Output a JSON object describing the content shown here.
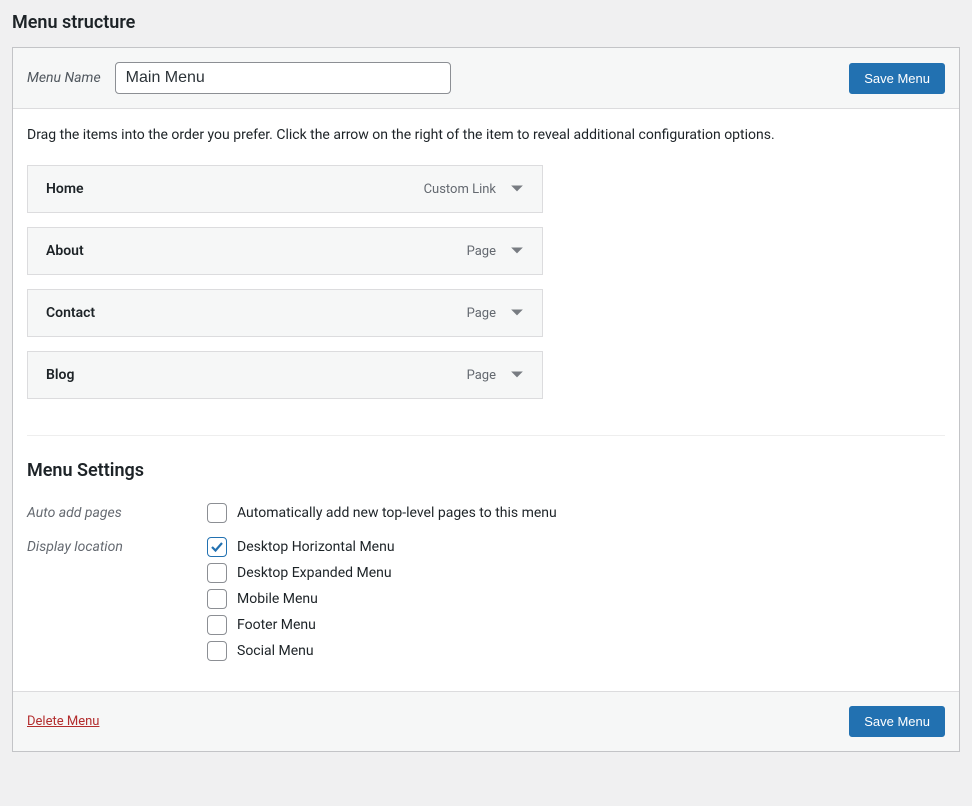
{
  "page": {
    "title": "Menu structure"
  },
  "header": {
    "menu_name_label": "Menu Name",
    "menu_name_value": "Main Menu",
    "save_button": "Save Menu"
  },
  "body": {
    "instructions": "Drag the items into the order you prefer. Click the arrow on the right of the item to reveal additional configuration options."
  },
  "items": [
    {
      "title": "Home",
      "type": "Custom Link"
    },
    {
      "title": "About",
      "type": "Page"
    },
    {
      "title": "Contact",
      "type": "Page"
    },
    {
      "title": "Blog",
      "type": "Page"
    }
  ],
  "settings": {
    "title": "Menu Settings",
    "auto_add_label": "Auto add pages",
    "display_location_label": "Display location",
    "auto_add_option": {
      "label": "Automatically add new top-level pages to this menu",
      "checked": false
    },
    "locations": [
      {
        "label": "Desktop Horizontal Menu",
        "checked": true
      },
      {
        "label": "Desktop Expanded Menu",
        "checked": false
      },
      {
        "label": "Mobile Menu",
        "checked": false
      },
      {
        "label": "Footer Menu",
        "checked": false
      },
      {
        "label": "Social Menu",
        "checked": false
      }
    ]
  },
  "footer": {
    "delete_link": "Delete Menu",
    "save_button": "Save Menu"
  }
}
